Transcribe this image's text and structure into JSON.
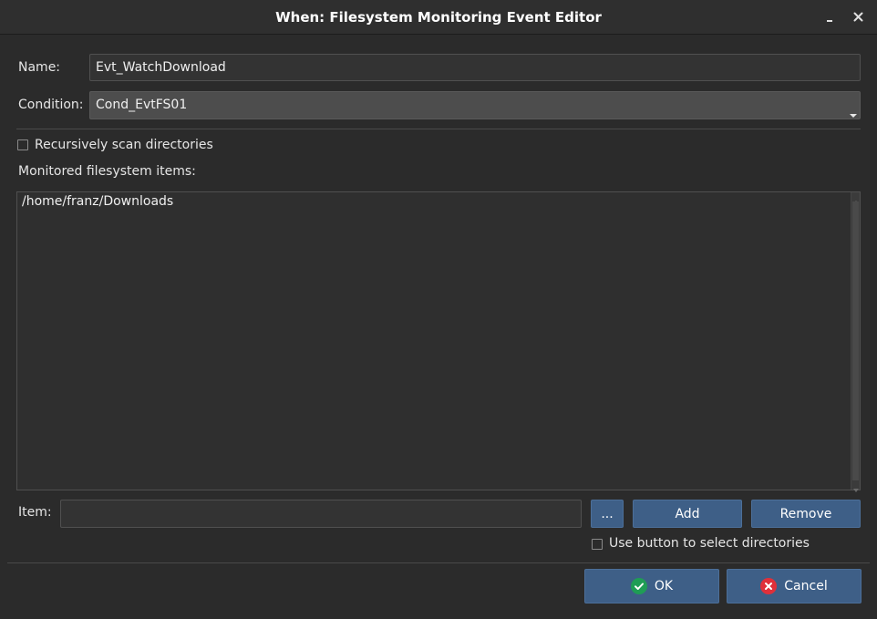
{
  "window": {
    "title": "When: Filesystem Monitoring Event Editor",
    "minimize_icon": "minimize-icon",
    "close_icon": "close-icon"
  },
  "form": {
    "name_label": "Name:",
    "name_value": "Evt_WatchDownload",
    "condition_label": "Condition:",
    "condition_value": "Cond_EvtFS01",
    "recursive_label": "Recursively scan directories",
    "recursive_checked": false,
    "monitored_label": "Monitored filesystem items:",
    "items": [
      "/home/franz/Downloads"
    ],
    "item_label": "Item:",
    "item_value": "",
    "browse_label": "...",
    "add_label": "Add",
    "remove_label": "Remove",
    "use_button_label": "Use button to select directories",
    "use_button_checked": false
  },
  "footer": {
    "ok_label": "OK",
    "cancel_label": "Cancel"
  },
  "colors": {
    "accent_button": "#3e5f87",
    "ok_icon": "#1f9d55",
    "cancel_icon": "#e0303a"
  }
}
